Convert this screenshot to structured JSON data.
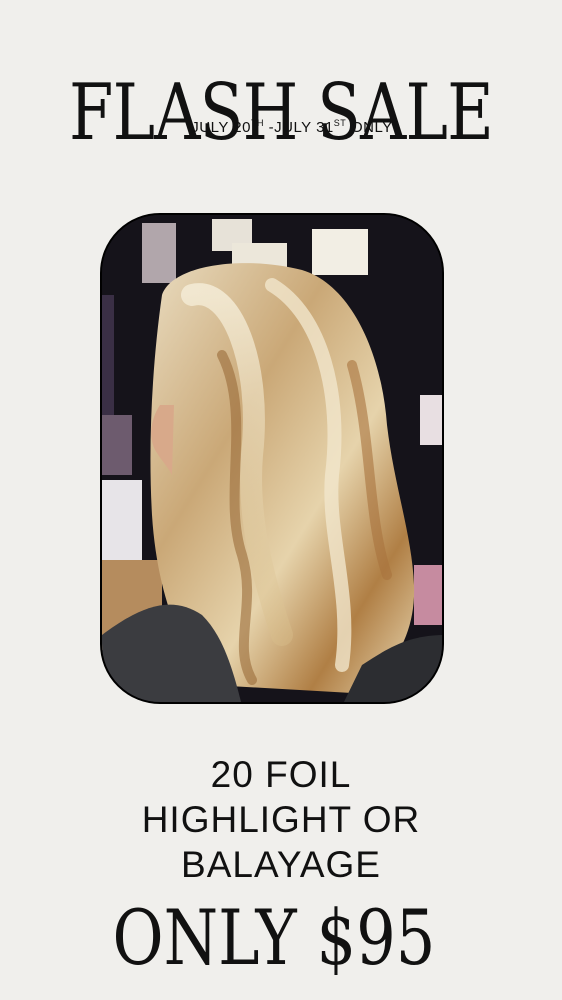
{
  "header": {
    "title": "FLASH SALE",
    "dates": {
      "start_prefix": "JULY 20",
      "start_suffix": "TH",
      "separator": " -JULY 31",
      "end_suffix": "ST",
      "tail": " ONLY"
    }
  },
  "photo": {
    "icon": "hair-photo"
  },
  "offer": {
    "line1": "20 FOIL",
    "line2": "HIGHLIGHT OR",
    "line3": "BALAYAGE"
  },
  "price": {
    "text": "ONLY $95"
  },
  "colors": {
    "background": "#f0efec",
    "text": "#111111"
  }
}
